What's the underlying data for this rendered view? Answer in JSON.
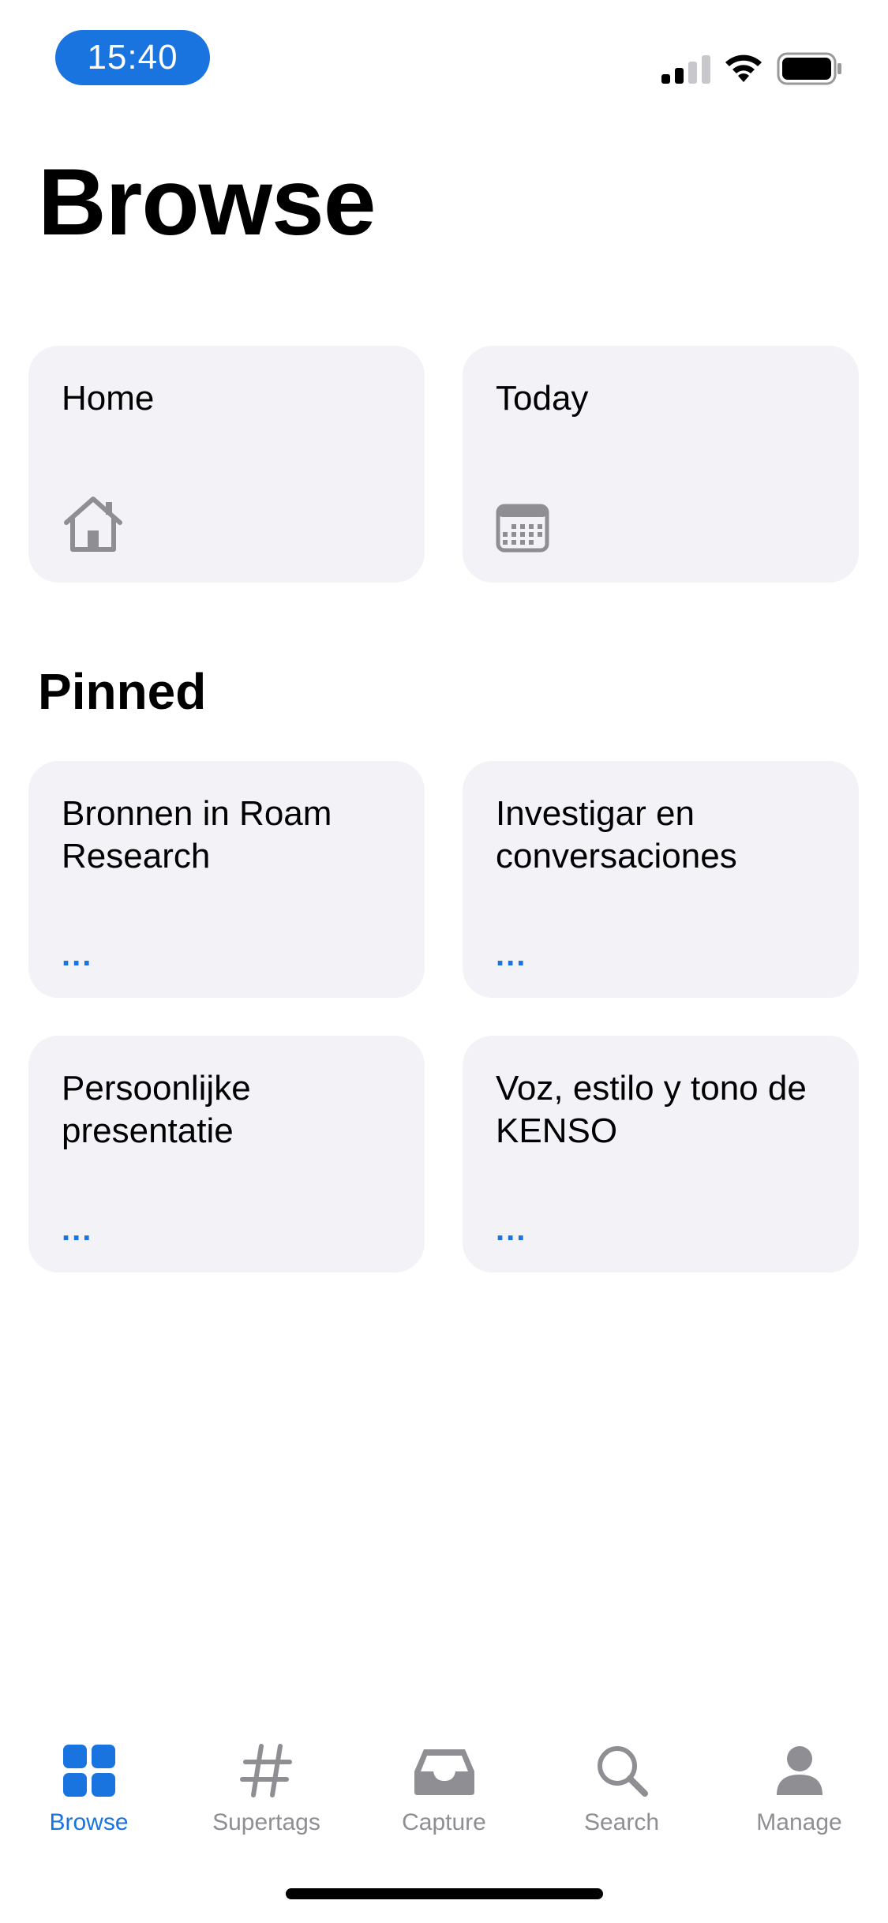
{
  "status_bar": {
    "time": "15:40",
    "signal_icon": "cellular-signal-icon",
    "wifi_icon": "wifi-icon",
    "battery_icon": "battery-icon"
  },
  "page": {
    "title": "Browse"
  },
  "quick_access": [
    {
      "label": "Home",
      "icon": "house-icon"
    },
    {
      "label": "Today",
      "icon": "calendar-icon"
    }
  ],
  "pinned": {
    "title": "Pinned",
    "items": [
      {
        "label": "Bronnen in Roam Research",
        "more": "..."
      },
      {
        "label": "Investigar en conversaciones",
        "more": "..."
      },
      {
        "label": "Persoonlijke presentatie",
        "more": "..."
      },
      {
        "label": "Voz, estilo y tono de KENSO",
        "more": "..."
      }
    ]
  },
  "tab_bar": {
    "active": "Browse",
    "tabs": [
      {
        "label": "Browse",
        "icon": "grid-icon"
      },
      {
        "label": "Supertags",
        "icon": "hashtag-icon"
      },
      {
        "label": "Capture",
        "icon": "inbox-tray-icon"
      },
      {
        "label": "Search",
        "icon": "magnifier-icon"
      },
      {
        "label": "Manage",
        "icon": "person-icon"
      }
    ]
  },
  "colors": {
    "accent": "#1a74e0",
    "card_background": "#f2f2f7",
    "inactive_tab": "#8e8e93"
  }
}
